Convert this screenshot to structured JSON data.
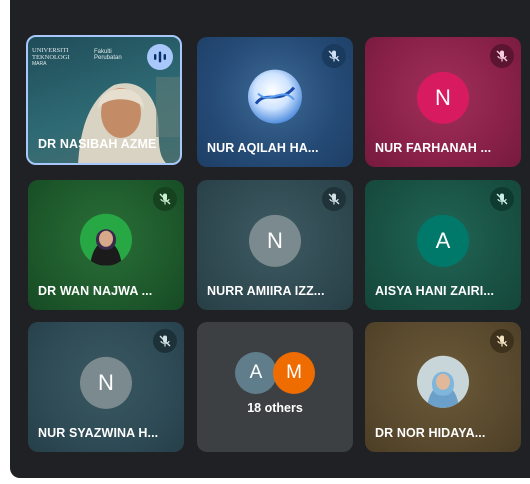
{
  "participants": [
    {
      "name": "DR NASIBAH AZME",
      "bg": "#2b5e6b",
      "speaking": true
    },
    {
      "name": "NUR AQILAH HA...",
      "bg": "#274f78"
    },
    {
      "name": "NUR FARHANAH ...",
      "bg": "#8a2148",
      "initial": "N",
      "avatar_color": "#d81b60"
    },
    {
      "name": "DR WAN NAJWA ...",
      "bg": "#1e5a2c"
    },
    {
      "name": "NURR AMIIRA IZZ...",
      "bg": "#304a52",
      "initial": "N",
      "avatar_color": "#7b8a8f"
    },
    {
      "name": "AISYA HANI ZAIRI...",
      "bg": "#195244",
      "initial": "A",
      "avatar_color": "#00796b"
    },
    {
      "name": "NUR SYAZWINA H...",
      "bg": "#2e4b56",
      "initial": "N",
      "avatar_color": "#7b8a8f"
    },
    {
      "name": "",
      "bg": "#3c4043",
      "others": true
    },
    {
      "name": "DR NOR HIDAYA...",
      "bg": "#5a4a2e"
    }
  ],
  "others": {
    "label": "18 others",
    "a_initial": "A",
    "m_initial": "M",
    "a_color": "#607d8b",
    "m_color": "#ef6c00"
  },
  "speaking_tile_text": {
    "line1": "UNIVERSITI",
    "line2": "TEKNOLOGI",
    "line3": "MARA",
    "line4": "Fakulti",
    "line5": "Perubatan"
  },
  "mic_icon": "mic-off-icon",
  "active_icon": "audio-bars-icon"
}
